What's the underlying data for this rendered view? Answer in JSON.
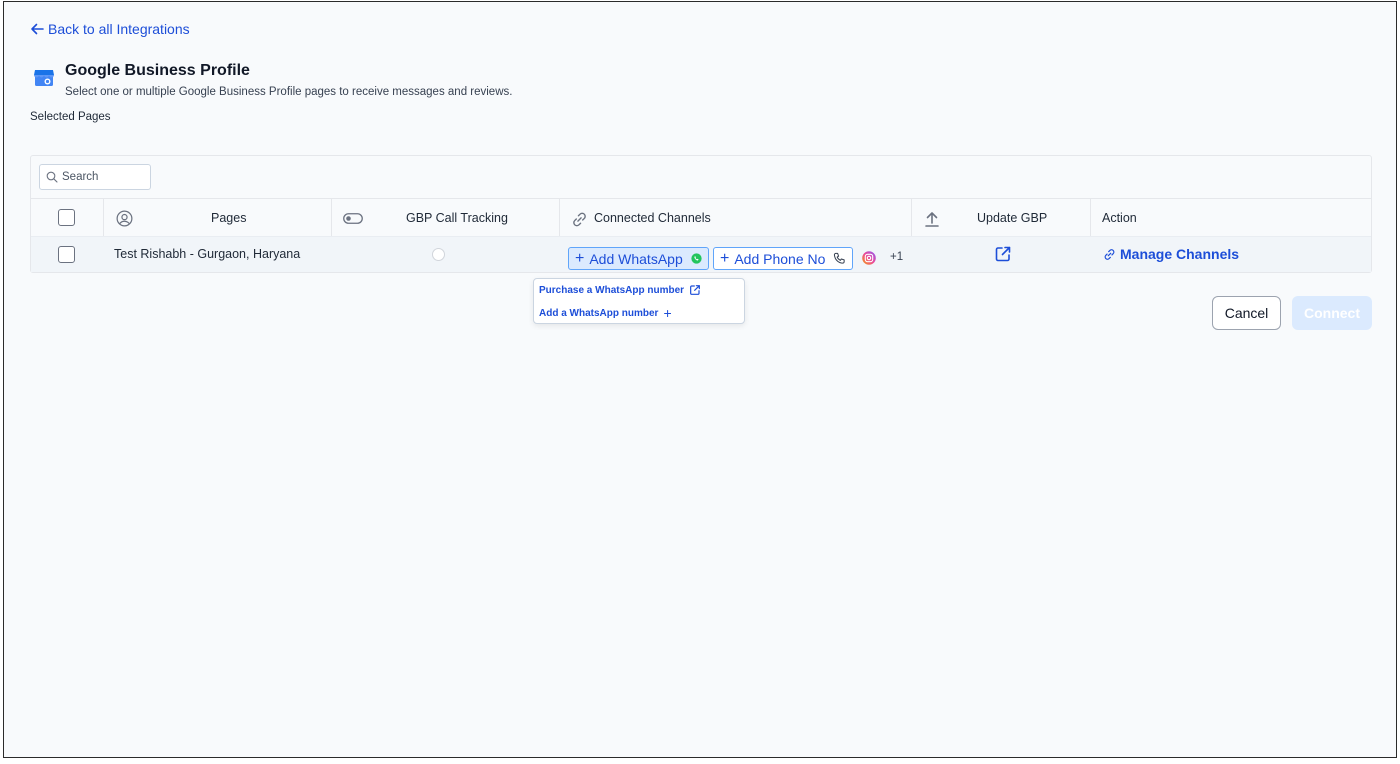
{
  "nav": {
    "back_label": "Back to all Integrations"
  },
  "header": {
    "title": "Google Business Profile",
    "subtitle": "Select one or multiple Google Business Profile pages to receive messages and reviews."
  },
  "selected_pages_label": "Selected Pages",
  "search": {
    "placeholder": "Search"
  },
  "table": {
    "columns": {
      "pages": "Pages",
      "call_tracking": "GBP Call Tracking",
      "connected_channels": "Connected Channels",
      "update_gbp": "Update GBP",
      "action": "Action"
    },
    "rows": [
      {
        "page_name": "Test Rishabh - Gurgaon, Haryana",
        "call_tracking_enabled": false,
        "add_whatsapp_label": "Add WhatsApp",
        "add_phone_label": "Add Phone No",
        "more_channels": "+1",
        "action_label": "Manage Channels"
      }
    ]
  },
  "whatsapp_menu": {
    "purchase_label": "Purchase a WhatsApp number",
    "add_label": "Add a WhatsApp number"
  },
  "buttons": {
    "cancel": "Cancel",
    "connect": "Connect"
  },
  "colors": {
    "accent": "#1d4ed8",
    "whatsapp": "#22c55e",
    "connect_disabled": "#dbeafe"
  }
}
